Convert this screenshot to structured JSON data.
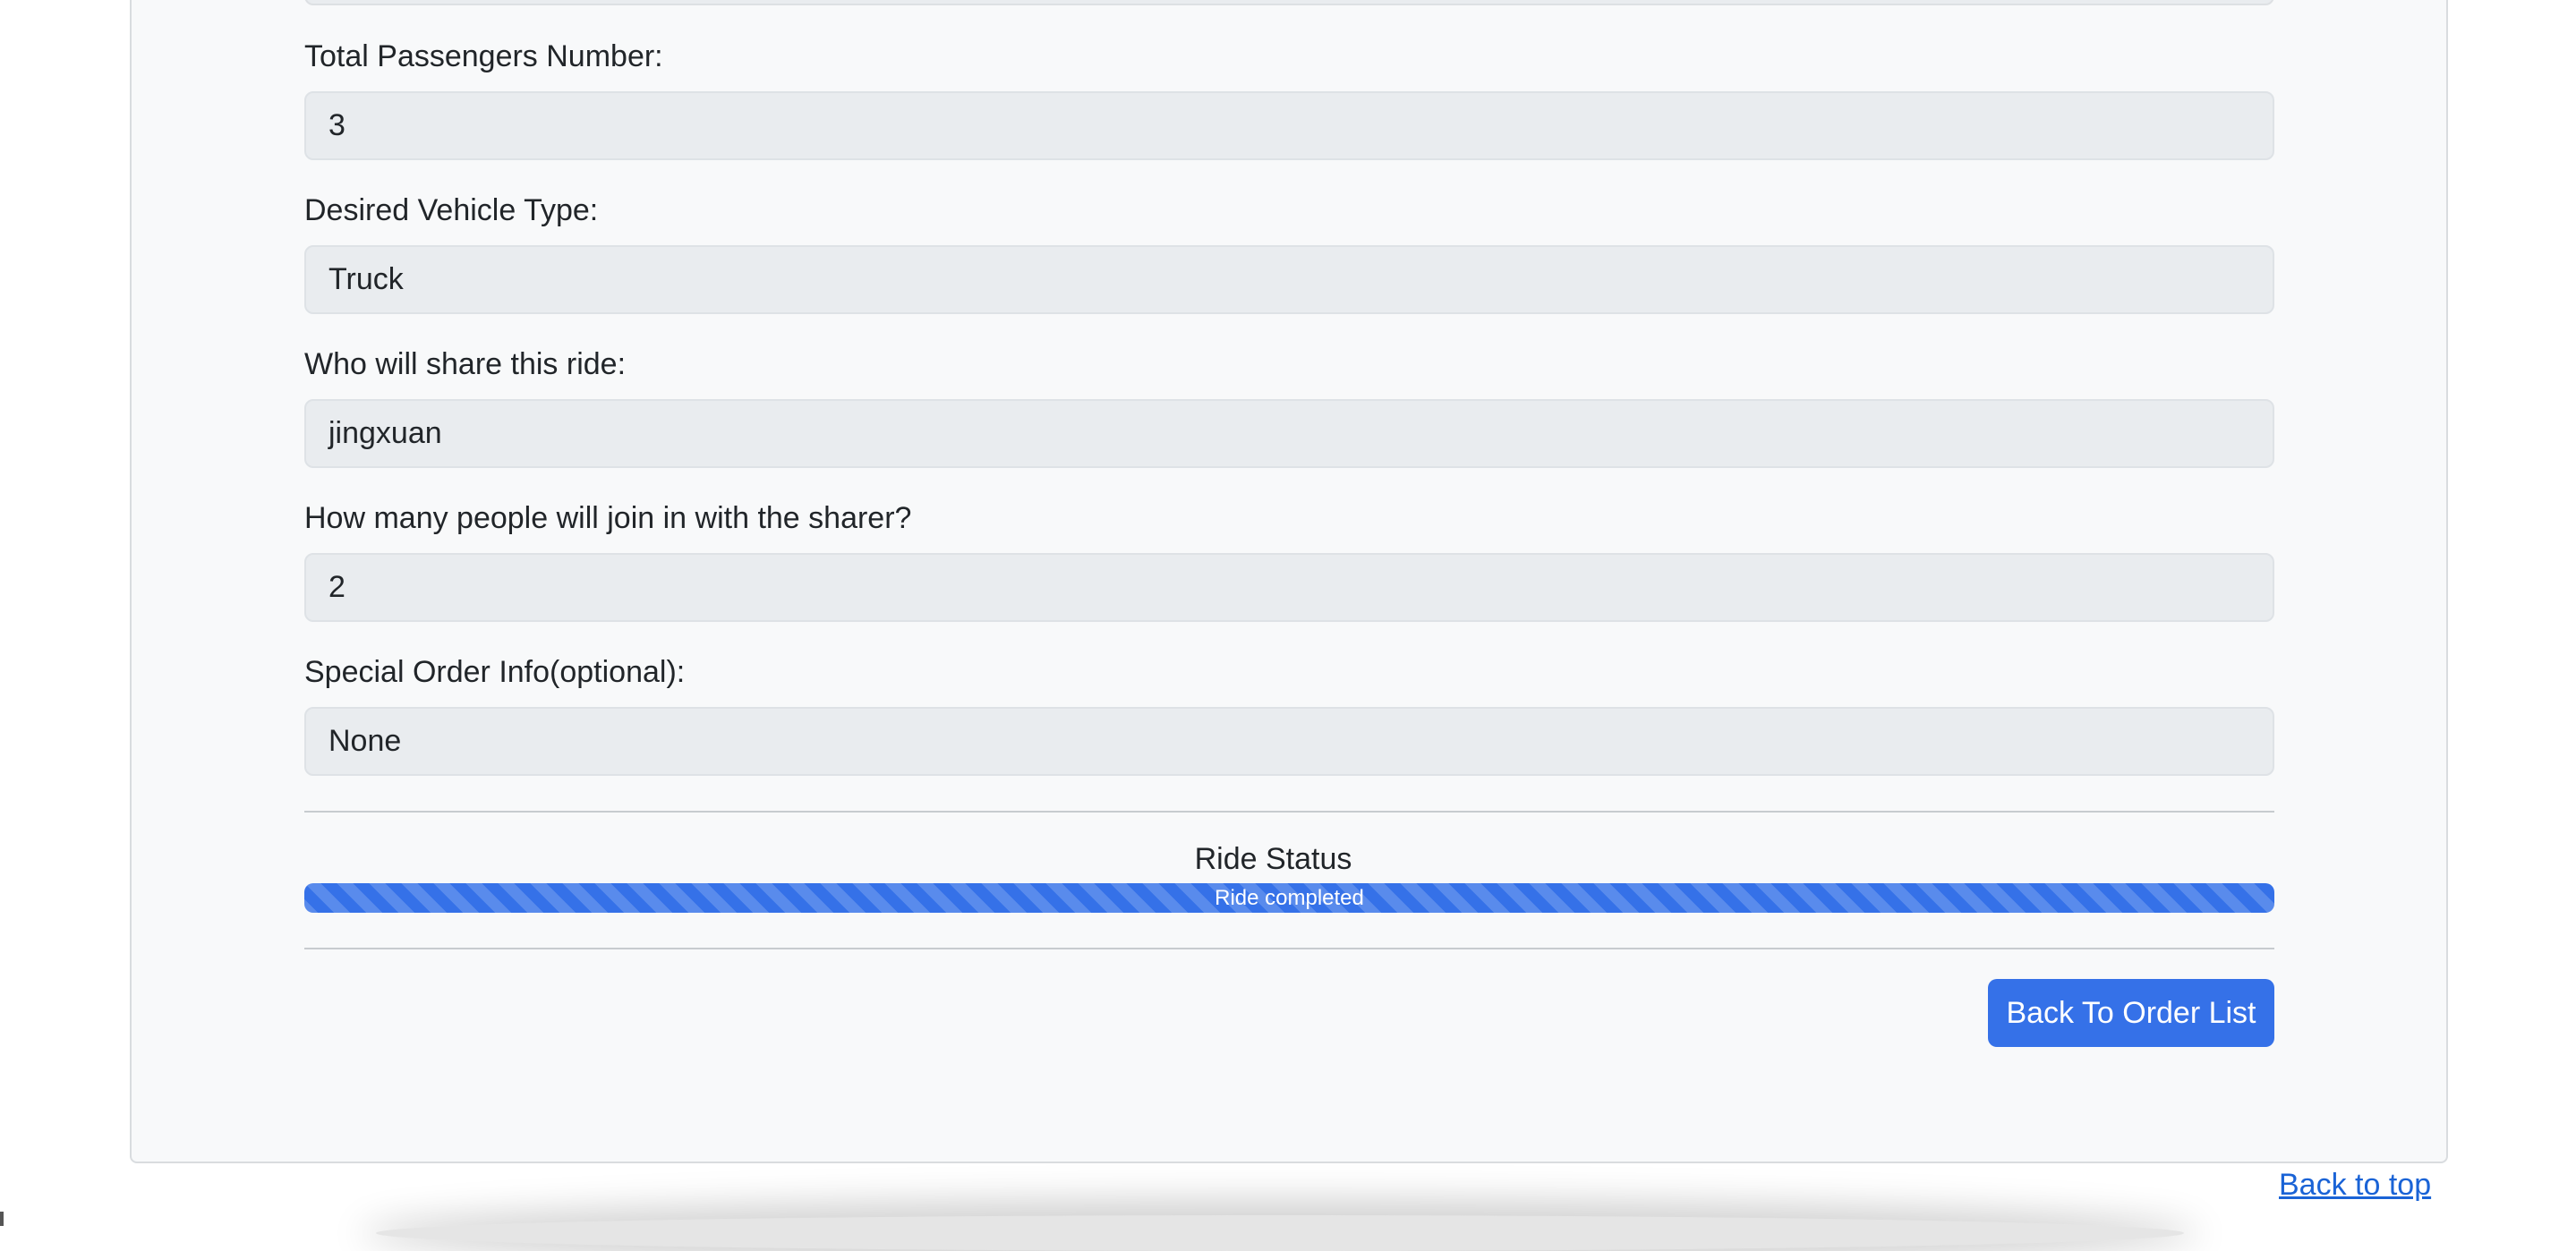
{
  "order_form": {
    "fields": [
      {
        "label": "Total Passengers Number:",
        "value": "3"
      },
      {
        "label": "Desired Vehicle Type:",
        "value": "Truck"
      },
      {
        "label": "Who will share this ride:",
        "value": "jingxuan"
      },
      {
        "label": "How many people will join in with the sharer?",
        "value": "2"
      },
      {
        "label": "Special Order Info(optional):",
        "value": "None"
      }
    ]
  },
  "ride_status": {
    "title": "Ride Status",
    "progress_label": "Ride completed",
    "progress_percent": 100,
    "bar_color": "#3571e8"
  },
  "actions": {
    "back_to_order_list": "Back To Order List"
  },
  "footer": {
    "back_to_top": "Back to top"
  },
  "colors": {
    "card_background": "#f8f9fa",
    "input_background": "#e9ecef",
    "primary": "#3571e8",
    "link": "#1a63d6"
  }
}
